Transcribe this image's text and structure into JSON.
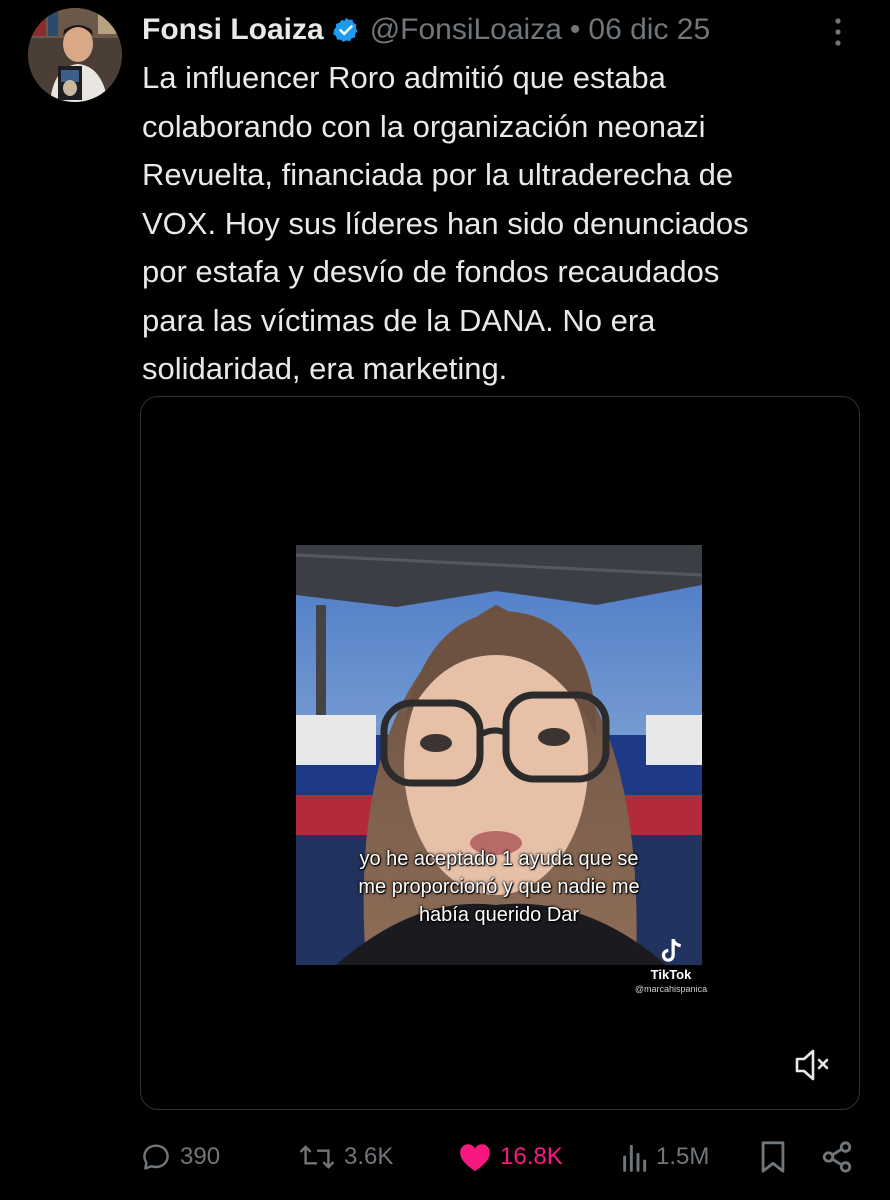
{
  "tweet": {
    "author_name": "Fonsi Loaiza",
    "handle": "@FonsiLoaiza",
    "separator": "•",
    "date": "06 dic 25",
    "text": "La influencer Roro admitió que estaba\ncolaborando con la organización neonazi\nRevuelta, financiada por la ultraderecha de\nVOX. Hoy sus líderes han sido denunciados\npor estafa y desvío de fondos recaudados\npara las víctimas de la DANA. No era\nsolidaridad, era marketing."
  },
  "icons": {
    "verified": "verified-badge-icon",
    "more": "more-options-icon",
    "mute": "volume-muted-icon",
    "reply": "reply-icon",
    "repost": "repost-icon",
    "like": "like-heart-icon",
    "views": "views-chart-icon",
    "bookmark": "bookmark-icon",
    "share": "share-icon"
  },
  "colors": {
    "background": "#000000",
    "text": "#e7e9ea",
    "muted": "#71767b",
    "verified": "#1d9bf0",
    "like": "#f91880"
  },
  "video": {
    "subtitle": "yo he aceptado 1 ayuda que se\nme proporcionó y que nadie me\nhabía querido Dar",
    "watermark_label": "TikTok",
    "watermark_user": "@marcahispanica",
    "muted": true
  },
  "stats": {
    "replies": "390",
    "reposts": "3.6K",
    "likes": "16.8K",
    "views": "1.5M"
  }
}
